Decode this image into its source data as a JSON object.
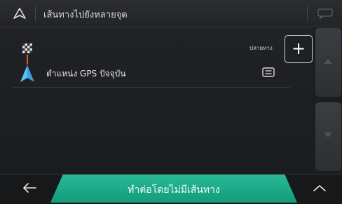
{
  "header": {
    "title": "เส้นทางไปยังหลายจุด"
  },
  "route": {
    "destination_label": "ปลายทาง",
    "add_label": "+",
    "start_point_label": "ตำแหน่ง GPS ปัจจุบัน"
  },
  "footer": {
    "main_action_label": "ทำต่อโดยไม่มีเส้นทาง"
  },
  "icons": {
    "navigation": "navigation-arrow-icon",
    "chat": "speech-bubble-icon",
    "destination": "checkered-flag-icon",
    "start": "blue-arrow-icon",
    "menu": "menu-icon",
    "back": "back-arrow-icon",
    "expand": "chevron-up-icon",
    "scroll_up": "triangle-up-icon",
    "scroll_down": "triangle-down-icon"
  },
  "colors": {
    "accent": "#1fae8a",
    "route_line": "#d85a2a",
    "start_arrow": "#3aa0e0"
  }
}
